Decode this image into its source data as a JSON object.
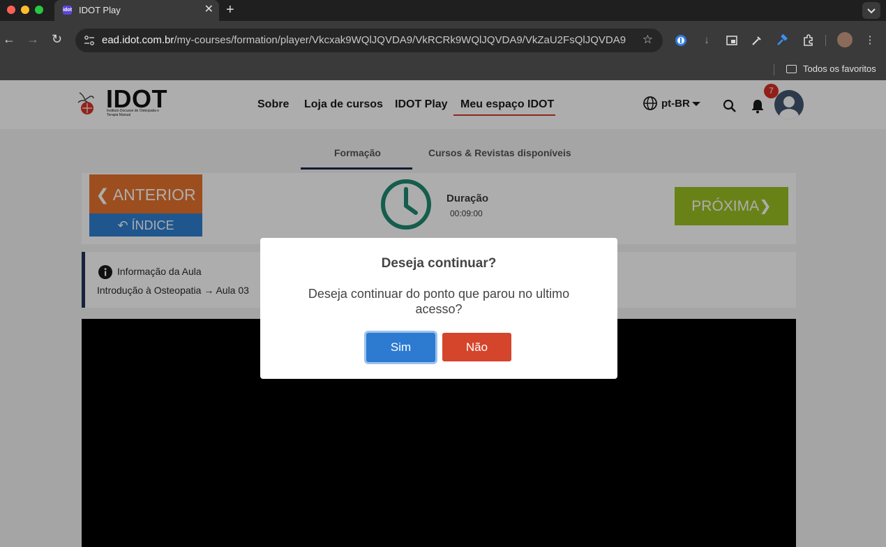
{
  "browser": {
    "tab_title": "IDOT Play",
    "tab_favicon_text": "idot",
    "url_host": "ead.idot.com.br",
    "url_path": "/my-courses/formation/player/Vkcxak9WQlJQVDA9/VkRCRk9WQlJQVDA9/VkZaU2FsQlJQVDA9",
    "bookmarks_folder": "Todos os favoritos",
    "icons": {
      "close": "close-icon",
      "new_tab": "plus-icon",
      "back": "back-arrow-icon",
      "forward": "forward-arrow-icon",
      "reload": "reload-icon",
      "star": "star-icon",
      "folder": "folder-icon"
    }
  },
  "site": {
    "logo_text": "IDOT",
    "logo_subtitle": "Instituto Docusse de Osteopatia e Terapia Manual",
    "nav": {
      "sobre": "Sobre",
      "loja": "Loja de cursos",
      "play": "IDOT Play",
      "meu_espaco": "Meu espaço IDOT"
    },
    "language": "pt-BR",
    "notifications_count": "7",
    "subtabs": {
      "formacao": "Formação",
      "cursos": "Cursos & Revistas disponíveis"
    },
    "colors": {
      "anterior": "#e8742d",
      "indice": "#2f7fd1",
      "proxima": "#9bc022",
      "clock": "#1f8a70",
      "accent_red": "#d43a2a"
    }
  },
  "player": {
    "anterior_label": "ANTERIOR",
    "indice_label": "ÍNDICE",
    "duration_label": "Duração",
    "duration_value": "00:09:00",
    "proxima_label": "PRÓXIMA",
    "info_title": "Informação da Aula",
    "info_path": "Introdução à Osteopatia → Aula 03"
  },
  "modal": {
    "title": "Deseja continuar?",
    "text": "Deseja continuar do ponto que parou no ultimo acesso?",
    "yes": "Sim",
    "no": "Não",
    "colors": {
      "yes": "#2c7bd1",
      "no": "#d4452b"
    }
  }
}
